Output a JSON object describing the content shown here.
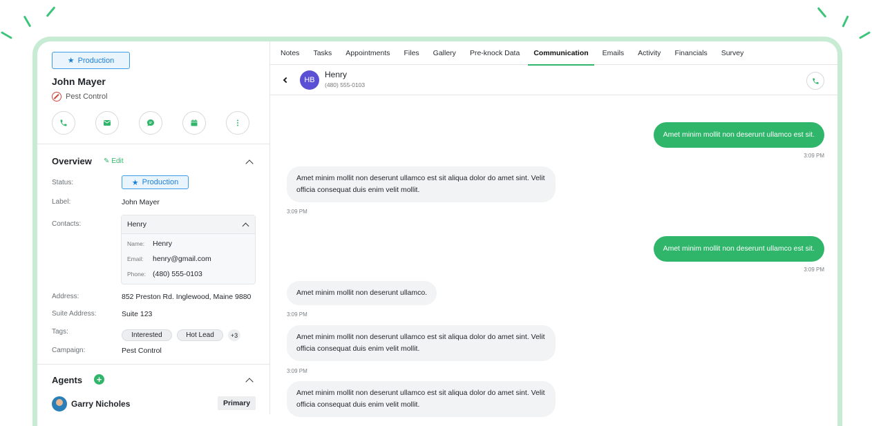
{
  "header": {
    "status_badge": "Production",
    "name": "John Mayer",
    "service": "Pest Control"
  },
  "quick_actions": [
    "phone-icon",
    "email-icon",
    "chat-icon",
    "calendar-icon",
    "more-icon"
  ],
  "overview": {
    "title": "Overview",
    "edit_label": "Edit",
    "status_label": "Status:",
    "status_value": "Production",
    "label_label": "Label:",
    "label_value": "John Mayer",
    "contacts_label": "Contacts:",
    "contact": {
      "header": "Henry",
      "name_key": "Name:",
      "name": "Henry",
      "email_key": "Email:",
      "email": "henry@gmail.com",
      "phone_key": "Phone:",
      "phone": "(480) 555-0103"
    },
    "address_label": "Address:",
    "address_value": "852 Preston Rd. Inglewood, Maine 9880",
    "suite_label": "Suite Address:",
    "suite_value": "Suite 123",
    "tags_label": "Tags:",
    "tags": [
      "Interested",
      "Hot Lead"
    ],
    "tags_more": "+3",
    "campaign_label": "Campaign:",
    "campaign_value": "Pest Control"
  },
  "agents": {
    "title": "Agents",
    "agent_name": "Garry Nicholes",
    "agent_role": "Primary"
  },
  "tabs": [
    "Notes",
    "Tasks",
    "Appointments",
    "Files",
    "Gallery",
    "Pre-knock Data",
    "Communication",
    "Emails",
    "Activity",
    "Financials",
    "Survey"
  ],
  "active_tab": "Communication",
  "chat": {
    "contact_initials": "HB",
    "contact_name": "Henry",
    "contact_phone": "(480) 555-0103",
    "messages": [
      {
        "dir": "out",
        "text": "Amet minim mollit non deserunt ullamco est sit.",
        "time": "3:09 PM"
      },
      {
        "dir": "in",
        "text": "Amet minim mollit non deserunt ullamco est sit aliqua dolor do amet sint. Velit officia consequat duis enim velit mollit.",
        "time": "3:09 PM"
      },
      {
        "dir": "out",
        "text": "Amet minim mollit non deserunt ullamco est sit.",
        "time": "3:09 PM"
      },
      {
        "dir": "in",
        "text": "Amet minim mollit non deserunt ullamco.",
        "time": "3:09 PM"
      },
      {
        "dir": "in",
        "text": "Amet minim mollit non deserunt ullamco est sit aliqua dolor do amet sint. Velit officia consequat duis enim velit mollit.",
        "time": "3:09 PM"
      },
      {
        "dir": "in",
        "text": "Amet minim mollit non deserunt ullamco est sit aliqua dolor do amet sint. Velit officia consequat duis enim velit mollit.",
        "time": ""
      }
    ]
  },
  "colors": {
    "accent_green": "#2fb66a",
    "badge_blue": "#1b7fd6",
    "avatar_purple": "#5b4fd6",
    "frame_green": "#c7ecd3"
  }
}
